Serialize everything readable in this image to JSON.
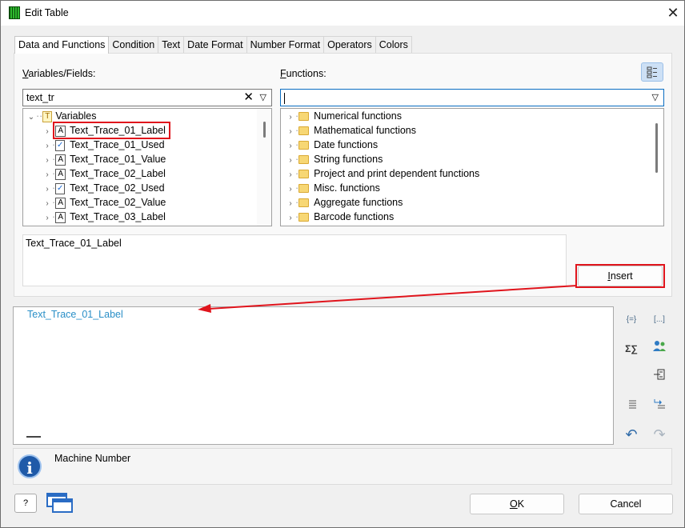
{
  "window": {
    "title": "Edit Table"
  },
  "tabs": [
    "Data and Functions",
    "Condition",
    "Text",
    "Date Format",
    "Number Format",
    "Operators",
    "Colors"
  ],
  "variables": {
    "label_prefix": "",
    "label_key": "V",
    "label_rest": "ariables/Fields:",
    "search_value": "text_tr",
    "tree_root": "Variables",
    "items": [
      {
        "name": "Text_Trace_01_Label",
        "type": "A",
        "selected": true
      },
      {
        "name": "Text_Trace_01_Used",
        "type": "bool"
      },
      {
        "name": "Text_Trace_01_Value",
        "type": "A"
      },
      {
        "name": "Text_Trace_02_Label",
        "type": "A"
      },
      {
        "name": "Text_Trace_02_Used",
        "type": "bool"
      },
      {
        "name": "Text_Trace_02_Value",
        "type": "A"
      },
      {
        "name": "Text_Trace_03_Label",
        "type": "A"
      }
    ]
  },
  "functions": {
    "label_key": "F",
    "label_rest": "unctions:",
    "search_value": "",
    "items": [
      "Numerical functions",
      "Mathematical functions",
      "Date functions",
      "String functions",
      "Project and print dependent functions",
      "Misc. functions",
      "Aggregate functions",
      "Barcode functions"
    ]
  },
  "description_text": "Text_Trace_01_Label",
  "insert_button": {
    "key": "I",
    "rest": "nsert"
  },
  "editor": {
    "content": "Text_Trace_01_Label",
    "content_color": "#2a8fc7"
  },
  "right_toolbar": [
    "{=}",
    "[...]",
    "Σ∑",
    "people",
    "insert-left",
    "align",
    "indent",
    "undo",
    "redo"
  ],
  "info": {
    "text": "Machine Number"
  },
  "ok_button": {
    "key": "O",
    "rest": "K"
  },
  "cancel_button": "Cancel",
  "colors": {
    "highlight": "#e0141c",
    "accent": "#0b6ec2",
    "info": "#1f5aa8"
  }
}
